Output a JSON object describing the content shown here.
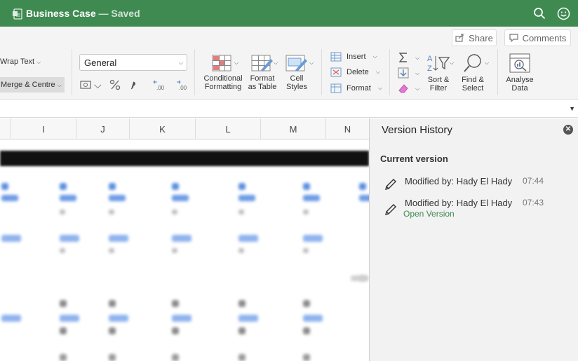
{
  "titlebar": {
    "doc_title": "Business Case",
    "status": " — Saved",
    "accent": "#3f8a51",
    "icons": [
      "document-icon",
      "search-icon",
      "smiley-icon"
    ]
  },
  "ribbon": {
    "share_label": "Share",
    "comments_label": "Comments",
    "wrap_text_label": "Wrap Text",
    "merge_centre_label": "Merge & Centre",
    "number_format_value": "General",
    "number_icons": [
      "currency-icon",
      "percent-icon",
      "comma-icon",
      "decrease-decimal-icon",
      "increase-decimal-icon"
    ],
    "conditional_formatting": [
      "Conditional",
      "Formatting"
    ],
    "format_as_table": [
      "Format",
      "as Table"
    ],
    "cell_styles": [
      "Cell",
      "Styles"
    ],
    "insert_label": "Insert",
    "delete_label": "Delete",
    "format_label": "Format",
    "sort_filter": [
      "Sort &",
      "Filter"
    ],
    "find_select": [
      "Find &",
      "Select"
    ],
    "analyse_data": [
      "Analyse",
      "Data"
    ]
  },
  "grid": {
    "columns": [
      "I",
      "J",
      "K",
      "L",
      "M",
      "N"
    ]
  },
  "version_history": {
    "title": "Version History",
    "current_label": "Current version",
    "entries": [
      {
        "who": "Modified by: Hady El Hady",
        "time": "07:44"
      },
      {
        "who": "Modified by: Hady El Hady",
        "time": "07:43",
        "action": "Open Version"
      }
    ]
  }
}
